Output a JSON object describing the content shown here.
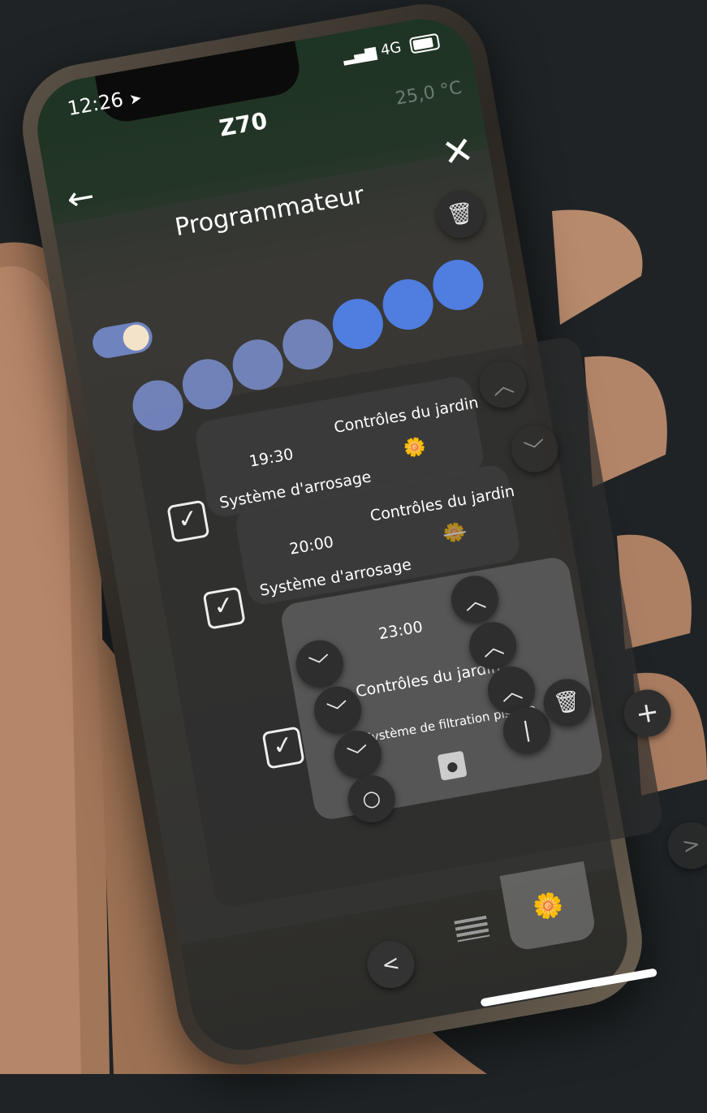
{
  "status_bar": {
    "time": "12:26",
    "network": "4G"
  },
  "header": {
    "title": "Z70",
    "temperature": "25,0 °C"
  },
  "dialog": {
    "title": "Programmateur",
    "close_icon": "close-icon",
    "delete_icon": "trash-icon"
  },
  "schedule": {
    "enabled": true,
    "days_active": [
      false,
      false,
      false,
      false,
      true,
      true,
      true
    ],
    "entries": [
      {
        "checked": true,
        "time": "19:30",
        "category": "Contrôles du jardin",
        "device": "Système d'arrosage",
        "icon": "flower-icon"
      },
      {
        "checked": true,
        "time": "20:00",
        "category": "Contrôles du jardin",
        "device": "Système d'arrosage",
        "icon": "flower-off-icon"
      },
      {
        "checked": true,
        "time": "23:00",
        "category": "Contrôles du jardin",
        "device": "Système de filtration piscine",
        "icon": "socket-icon",
        "editing": true
      }
    ]
  },
  "buttons": {
    "add_icon": "plus-icon",
    "prev_icon": "chevron-left-icon",
    "next_icon": "chevron-right-icon"
  },
  "colors": {
    "accent_active": "#4f7de0",
    "accent_inactive": "#7a8fd0",
    "toggle_knob": "#f3e3c9"
  }
}
